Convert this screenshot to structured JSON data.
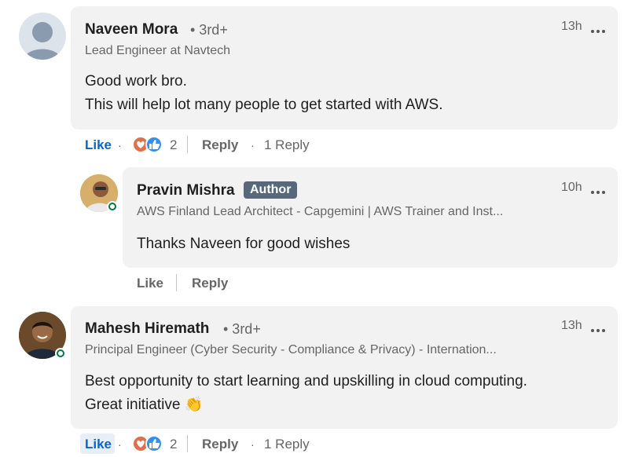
{
  "comments": [
    {
      "name": "Naveen Mora",
      "degree": "• 3rd+",
      "headline": "Lead Engineer at Navtech",
      "time": "13h",
      "body_lines": [
        "Good work bro.",
        "This will help lot many people to get started with AWS."
      ],
      "like": "Like",
      "reaction_count": "2",
      "reply": "Reply",
      "replies": "1 Reply"
    },
    {
      "name": "Pravin Mishra",
      "badge": "Author",
      "headline": "AWS Finland Lead Architect - Capgemini | AWS Trainer and Inst...",
      "time": "10h",
      "body_lines": [
        "Thanks Naveen for good wishes"
      ],
      "like": "Like",
      "reply": "Reply"
    },
    {
      "name": "Mahesh Hiremath",
      "degree": "• 3rd+",
      "headline": "Principal Engineer (Cyber Security - Compliance & Privacy) - Internation...",
      "time": "13h",
      "body_lines": [
        "Best opportunity to start learning and upskilling in cloud computing.",
        "Great initiative 👏"
      ],
      "like": "Like",
      "reaction_count": "2",
      "reply": "Reply",
      "replies": "1 Reply"
    }
  ],
  "colors": {
    "accent": "#0a66c2",
    "bubble": "#f2f2f2",
    "author_badge": "#56687a",
    "online": "#057642"
  }
}
